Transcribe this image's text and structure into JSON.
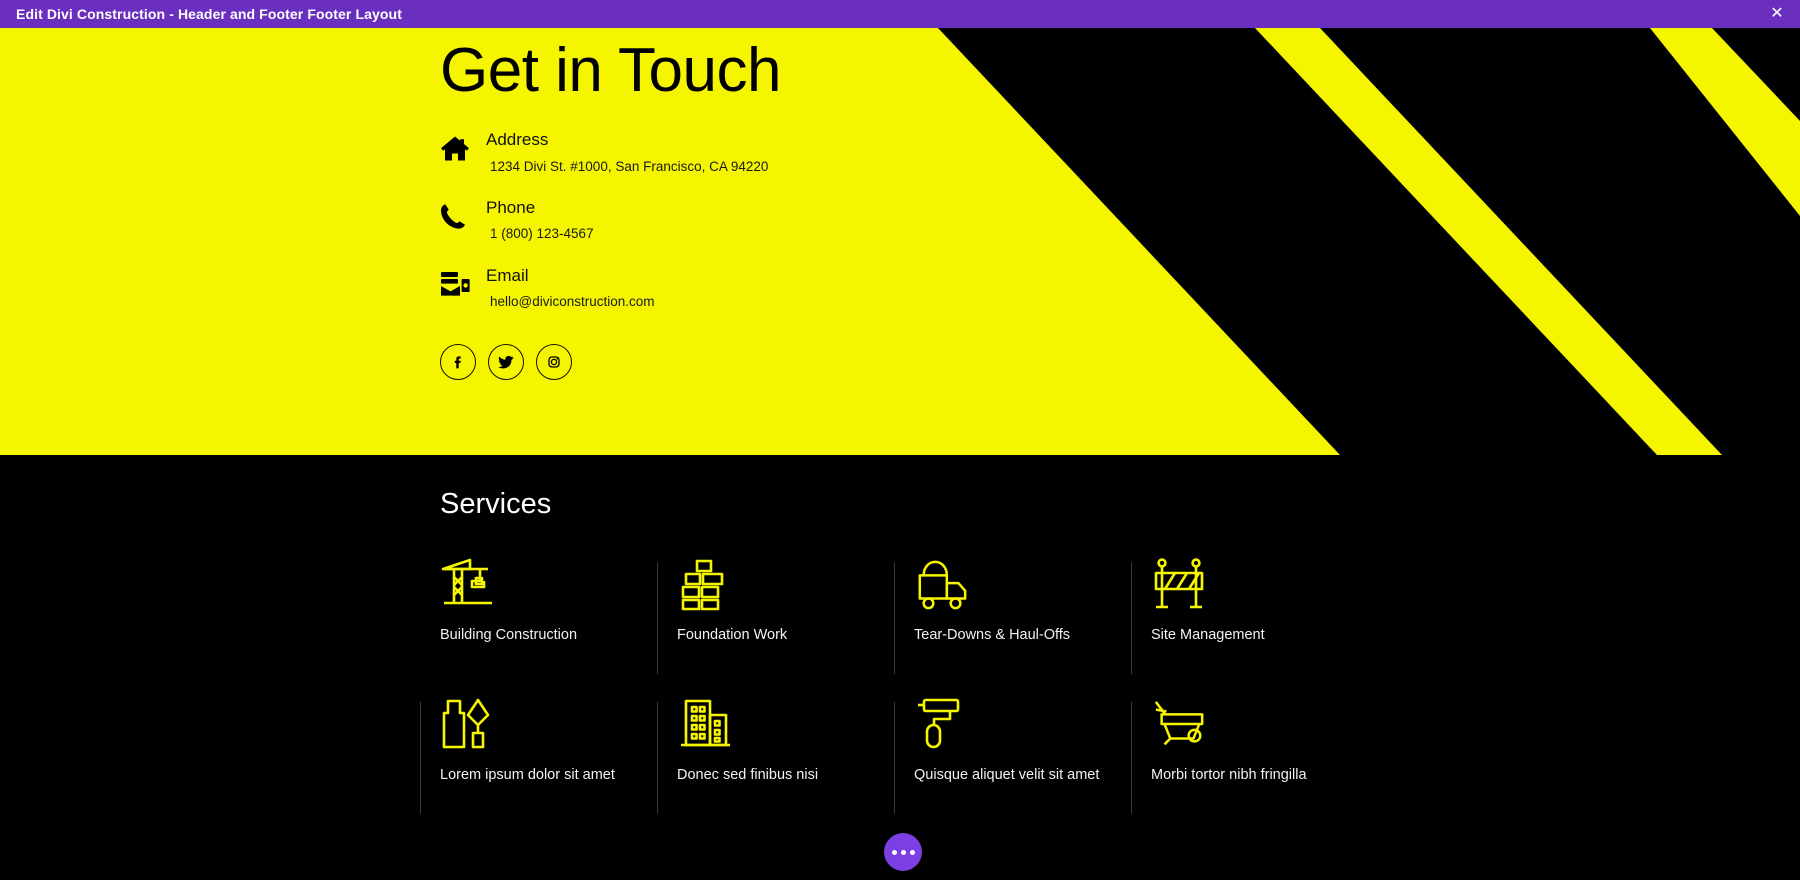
{
  "titlebar": {
    "title": "Edit Divi Construction - Header and Footer Footer Layout",
    "close_label": "✕"
  },
  "colors": {
    "titlebar_bg": "#6b2fc0",
    "hero_yellow": "#f5f500",
    "section_black": "#000000",
    "accent_purple": "#7b3fe4",
    "icon_yellow": "#f5f500"
  },
  "hero": {
    "title": "Get in Touch",
    "contacts": [
      {
        "icon": "home-icon",
        "label": "Address",
        "value": "1234 Divi St. #1000, San Francisco, CA 94220"
      },
      {
        "icon": "phone-icon",
        "label": "Phone",
        "value": "1 (800) 123-4567"
      },
      {
        "icon": "email-icon",
        "label": "Email",
        "value": "hello@diviconstruction.com"
      }
    ],
    "socials": [
      {
        "icon": "facebook-icon",
        "name": "Facebook"
      },
      {
        "icon": "twitter-icon",
        "name": "Twitter"
      },
      {
        "icon": "instagram-icon",
        "name": "Instagram"
      }
    ]
  },
  "services": {
    "title": "Services",
    "items": [
      {
        "icon": "crane-icon",
        "label": "Building Construction"
      },
      {
        "icon": "brick-wall-icon",
        "label": "Foundation Work"
      },
      {
        "icon": "dump-truck-icon",
        "label": "Tear-Downs & Haul-Offs"
      },
      {
        "icon": "barricade-icon",
        "label": "Site Management"
      },
      {
        "icon": "tools-icon",
        "label": "Lorem ipsum dolor sit amet"
      },
      {
        "icon": "buildings-icon",
        "label": "Donec sed finibus nisi"
      },
      {
        "icon": "paint-roller-icon",
        "label": "Quisque aliquet velit sit amet"
      },
      {
        "icon": "wheelbarrow-icon",
        "label": "Morbi tortor nibh fringilla"
      }
    ]
  },
  "fab": {
    "icon": "ellipsis-icon",
    "name": "Divi builder menu"
  }
}
